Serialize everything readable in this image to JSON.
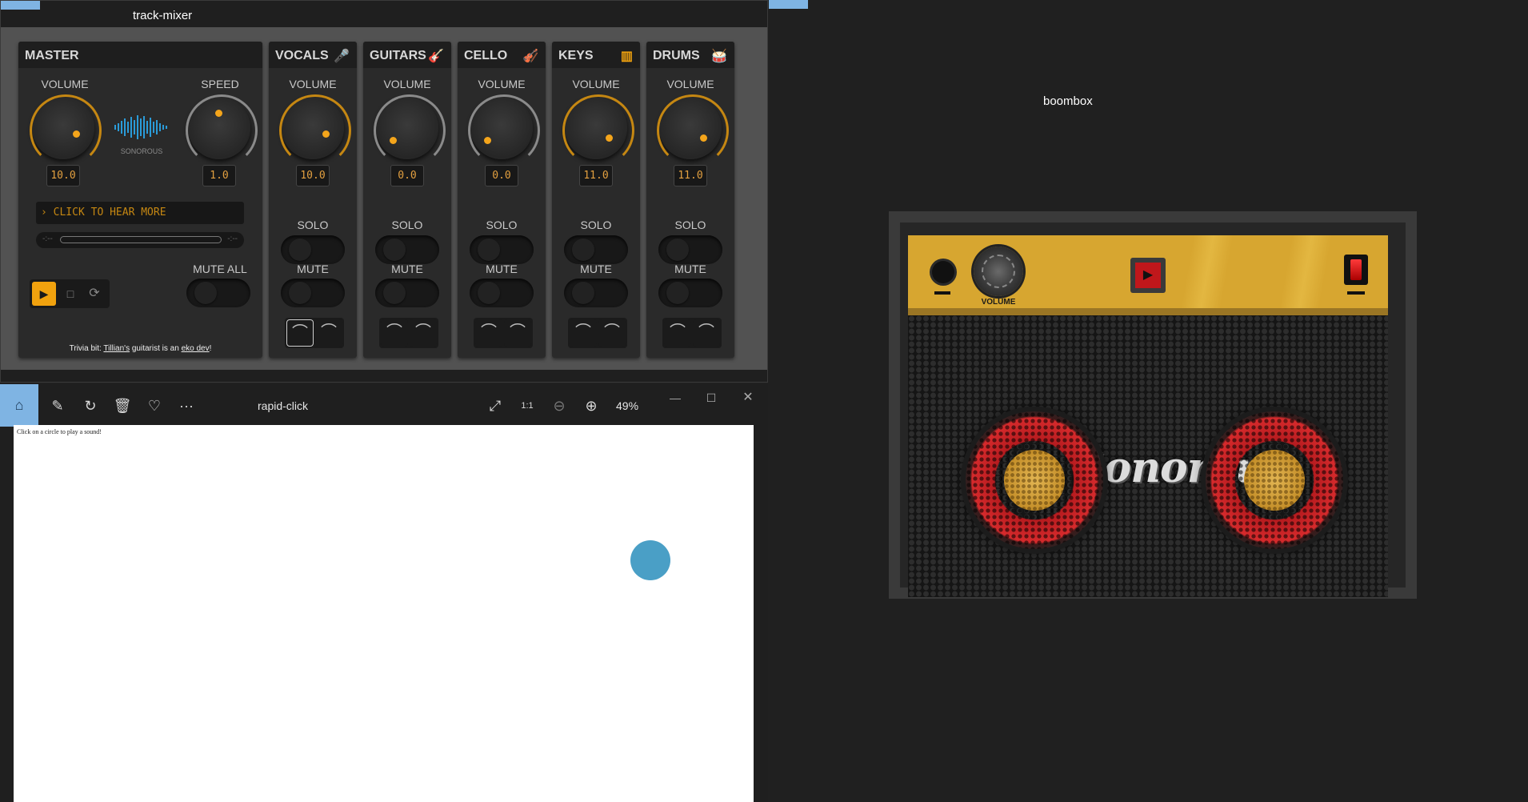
{
  "mixer": {
    "window_title": "track-mixer",
    "master": {
      "header": "MASTER",
      "volume_label": "VOLUME",
      "volume_value": "10.0",
      "speed_label": "SPEED",
      "speed_value": "1.0",
      "logo_text": "SONOROUS",
      "marquee_text": "CLICK TO HEAR MORE",
      "time_left": "-:--",
      "time_right": "-:--",
      "mute_all_label": "MUTE ALL",
      "trivia_prefix": "Trivia bit: ",
      "trivia_link1": "Tillian's",
      "trivia_mid": " guitarist is an ",
      "trivia_link2": "eko dev",
      "trivia_suffix": "!"
    },
    "channels": [
      {
        "name": "VOCALS",
        "icon": "microphone-icon",
        "volume_label": "VOLUME",
        "volume": "10.0",
        "solo_label": "SOLO",
        "mute_label": "MUTE"
      },
      {
        "name": "GUITARS",
        "icon": "guitar-icon",
        "volume_label": "VOLUME",
        "volume": "0.0",
        "solo_label": "SOLO",
        "mute_label": "MUTE"
      },
      {
        "name": "CELLO",
        "icon": "cello-icon",
        "volume_label": "VOLUME",
        "volume": "0.0",
        "solo_label": "SOLO",
        "mute_label": "MUTE"
      },
      {
        "name": "KEYS",
        "icon": "keyboard-icon",
        "volume_label": "VOLUME",
        "volume": "11.0",
        "solo_label": "SOLO",
        "mute_label": "MUTE"
      },
      {
        "name": "DRUMS",
        "icon": "drum-icon",
        "volume_label": "VOLUME",
        "volume": "11.0",
        "solo_label": "SOLO",
        "mute_label": "MUTE"
      }
    ]
  },
  "viewer": {
    "window_title": "rapid-click",
    "zoom": "49%",
    "canvas_hint": "Click on a circle to play a sound!",
    "circle_color": "#4a9fc6"
  },
  "boombox": {
    "window_title": "boombox",
    "volume_label": "VOLUME",
    "brand": "Sonorous"
  },
  "colors": {
    "accent": "#f1a20e",
    "window_accent": "#7fb4e3",
    "amp_gold": "#d7a630",
    "speaker_red": "#d62a2c"
  }
}
